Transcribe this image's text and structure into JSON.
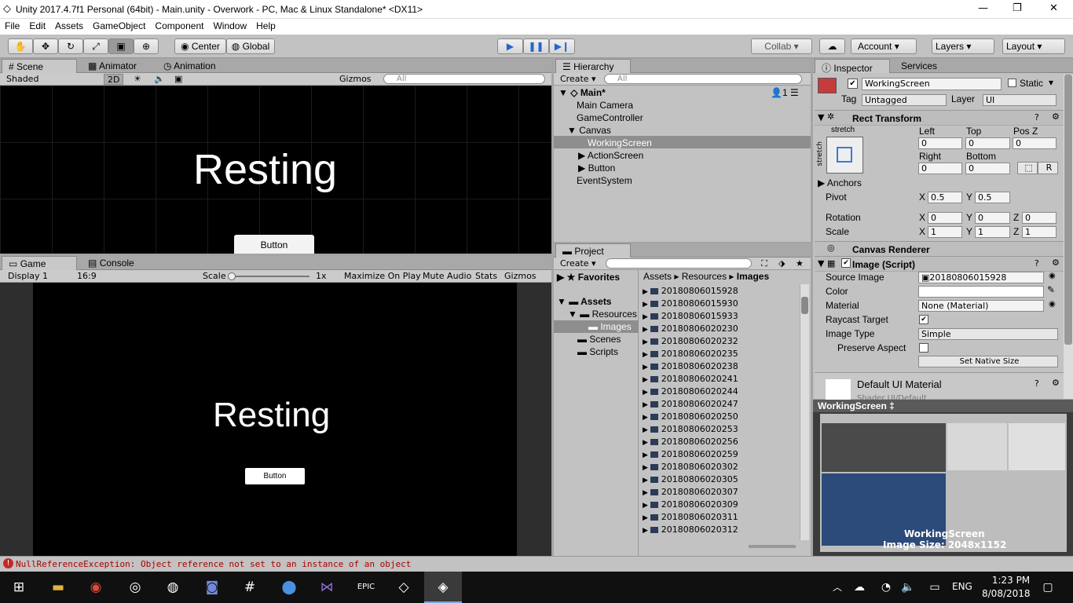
{
  "window": {
    "title": "Unity 2017.4.7f1 Personal (64bit) - Main.unity - Overwork - PC, Mac & Linux Standalone* <DX11>",
    "minimize": "—",
    "restore": "❐",
    "close": "✕"
  },
  "menu": [
    "File",
    "Edit",
    "Assets",
    "GameObject",
    "Component",
    "Window",
    "Help"
  ],
  "toolbar": {
    "pivot": "Center",
    "space": "Global",
    "collab": "Collab ▾",
    "account": "Account",
    "layers": "Layers",
    "layout": "Layout",
    "tools": [
      "hand-icon",
      "move-icon",
      "rotate-icon",
      "scale-icon",
      "rect-icon",
      "transform-icon"
    ]
  },
  "scene": {
    "tabs": [
      "Scene",
      "Animator",
      "Animation"
    ],
    "shading": "Shaded",
    "mode2d": "2D",
    "gizmos": "Gizmos",
    "search_placeholder": "All",
    "text": "Resting",
    "button": "Button"
  },
  "game": {
    "tabs": [
      "Game",
      "Console"
    ],
    "display": "Display 1",
    "aspect": "16:9",
    "scale_label": "Scale",
    "scale_value": "1x",
    "maximize": "Maximize On Play",
    "mute": "Mute Audio",
    "stats": "Stats",
    "gizmos": "Gizmos",
    "text": "Resting",
    "button": "Button"
  },
  "hierarchy": {
    "tab": "Hierarchy",
    "create": "Create",
    "search_placeholder": "All",
    "scene": "Main*",
    "count": "1",
    "items": [
      "Main Camera",
      "GameController",
      "Canvas",
      "WorkingScreen",
      "ActionScreen",
      "Button",
      "EventSystem"
    ]
  },
  "project": {
    "tab": "Project",
    "create": "Create",
    "favorites": "Favorites",
    "assets": "Assets",
    "tree": [
      "Resources",
      "Images",
      "Scenes",
      "Scripts"
    ],
    "breadcrumb": [
      "Assets",
      "Resources",
      "Images"
    ],
    "files": [
      "20180806015928",
      "20180806015930",
      "20180806015933",
      "20180806020230",
      "20180806020232",
      "20180806020235",
      "20180806020238",
      "20180806020241",
      "20180806020244",
      "20180806020247",
      "20180806020250",
      "20180806020253",
      "20180806020256",
      "20180806020259",
      "20180806020302",
      "20180806020305",
      "20180806020307",
      "20180806020309",
      "20180806020311",
      "20180806020312"
    ]
  },
  "inspector": {
    "tabs": [
      "Inspector",
      "Services"
    ],
    "name": "WorkingScreen",
    "static": "Static",
    "tag_label": "Tag",
    "tag": "Untagged",
    "layer_label": "Layer",
    "layer": "UI",
    "rect": {
      "title": "Rect Transform",
      "stretch": "stretch",
      "stretch_v": "stretch",
      "left_l": "Left",
      "top_l": "Top",
      "posz_l": "Pos Z",
      "left": "0",
      "top": "0",
      "posz": "0",
      "right_l": "Right",
      "bottom_l": "Bottom",
      "right": "0",
      "bottom": "0",
      "r_btn": "R",
      "anchors": "Anchors",
      "pivot": "Pivot",
      "pivot_x": "0.5",
      "pivot_y": "0.5",
      "rotation": "Rotation",
      "rot_x": "0",
      "rot_y": "0",
      "rot_z": "0",
      "scale": "Scale",
      "scale_x": "1",
      "scale_y": "1",
      "scale_z": "1",
      "x": "X",
      "y": "Y",
      "z": "Z"
    },
    "canvas_renderer": "Canvas Renderer",
    "image": {
      "title": "Image (Script)",
      "source_l": "Source Image",
      "source": "20180806015928",
      "color_l": "Color",
      "material_l": "Material",
      "material": "None (Material)",
      "raycast_l": "Raycast Target",
      "imagetype_l": "Image Type",
      "imagetype": "Simple",
      "preserve_l": "Preserve Aspect",
      "native": "Set Native Size"
    },
    "default_material": "Default UI Material",
    "shader": "Shader   UI/Default",
    "preview": {
      "title": "WorkingScreen ‡",
      "name": "WorkingScreen",
      "size": "Image Size: 2048x1152"
    }
  },
  "status": {
    "error": "NullReferenceException: Object reference not set to an instance of an object"
  },
  "taskbar": {
    "lang": "ENG",
    "time": "1:23 PM",
    "date": "8/08/2018",
    "icons": [
      "windows-icon",
      "explorer-icon",
      "chrome-icon",
      "app-icon",
      "spotify-icon",
      "discord-icon",
      "slack-icon",
      "maps-icon",
      "visual-studio-icon",
      "epic-games-icon",
      "unity-hub-icon",
      "unity-icon"
    ]
  }
}
